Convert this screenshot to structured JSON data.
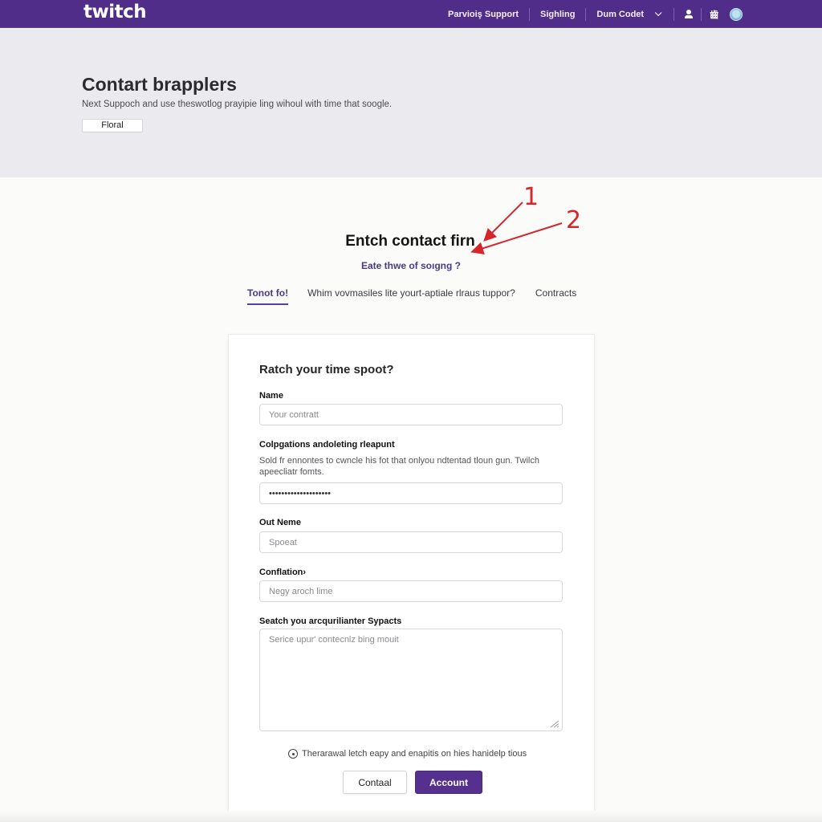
{
  "topbar": {
    "logo": "twitch",
    "nav": [
      {
        "label": "Parvioiş Support"
      },
      {
        "label": "Sighling"
      },
      {
        "label": "Dum Codet"
      }
    ],
    "icons": [
      "user-icon",
      "language-icon",
      "avatar"
    ],
    "lang_glyph": "齒",
    "brand_color": "#512d8a"
  },
  "hero": {
    "title": "Contart brapplers",
    "subtitle": "Next Suppoch and use theswotlog prayipie ling wihoul with time that soogle.",
    "button_label": "Floral"
  },
  "section": {
    "title": "Entch contact firn",
    "subtitle": "Eate thwe of soıgng ?",
    "annotations": [
      "1",
      "2"
    ],
    "annotation_color": "#d6262b"
  },
  "tabs": [
    {
      "label": "Tonot fo!",
      "active": true
    },
    {
      "label": "Whim vovmasiles lite yourt-aptiale rlraus tuppor?",
      "active": false
    },
    {
      "label": "Contracts",
      "active": false
    }
  ],
  "form": {
    "title": "Ratch your time spoot?",
    "fields": [
      {
        "label": "Name",
        "placeholder": "Your contratt",
        "value": ""
      },
      {
        "label": "Colpgations andoleting rleapunt",
        "help": "Sold fr ennontes to cwncle his fot that onlyou ndtentad tloun gun. Twilch apeecliatr fomts.",
        "value": "••••••••••••••••••••"
      },
      {
        "label": "Out Neme",
        "placeholder": "Spoeat",
        "value": ""
      },
      {
        "label": "Conflation›",
        "placeholder": "Negy aroch lime",
        "value": ""
      },
      {
        "label": "Seatch you arcqurilianter Sypacts",
        "placeholder": "Serice upur' contecnlz bing mouit",
        "value": ""
      }
    ],
    "note": "Therarawal letch eapy and enapitis on hies hanidelp tious",
    "secondary_button": "Contaal",
    "primary_button": "Account"
  }
}
